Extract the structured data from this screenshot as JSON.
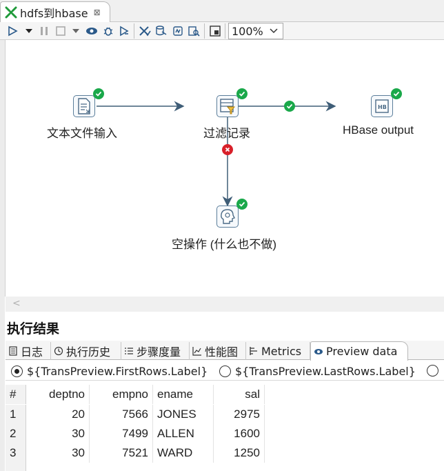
{
  "editor_tab": {
    "title": "hdfs到hbase",
    "close": "⊠"
  },
  "toolbar": {
    "zoom": "100%",
    "buttons": [
      "run-icon",
      "run-options-icon",
      "pause-icon",
      "stop-icon",
      "stop-options-icon",
      "preview-icon",
      "debug-icon",
      "replay-icon",
      "verify-icon",
      "impact-icon",
      "sql-icon",
      "explore-db-icon",
      "show-results-icon"
    ]
  },
  "canvas": {
    "steps": [
      {
        "label": "文本文件输入",
        "icon": "text-file-input-icon"
      },
      {
        "label": "过滤记录",
        "icon": "filter-rows-icon"
      },
      {
        "label": "HBase output",
        "icon": "hbase-output-icon"
      },
      {
        "label": "空操作 (什么也不做)",
        "icon": "dummy-step-icon"
      }
    ]
  },
  "results": {
    "title": "执行结果",
    "tabs": [
      "日志",
      "执行历史",
      "步骤度量",
      "性能图",
      "Metrics",
      "Preview data"
    ],
    "active_tab": "Preview data",
    "radio_first": "${TransPreview.FirstRows.Label}",
    "radio_last": "${TransPreview.LastRows.Label}",
    "grid": {
      "columns": [
        "#",
        "deptno",
        "empno",
        "ename",
        "sal"
      ],
      "rows": [
        [
          "1",
          "20",
          "7566",
          "JONES",
          "2975"
        ],
        [
          "2",
          "30",
          "7499",
          "ALLEN",
          "1600"
        ],
        [
          "3",
          "30",
          "7521",
          "WARD",
          "1250"
        ]
      ]
    }
  },
  "colors": {
    "ok": "#1aa84a",
    "error": "#d8202a",
    "hop": "#3f5d77"
  }
}
